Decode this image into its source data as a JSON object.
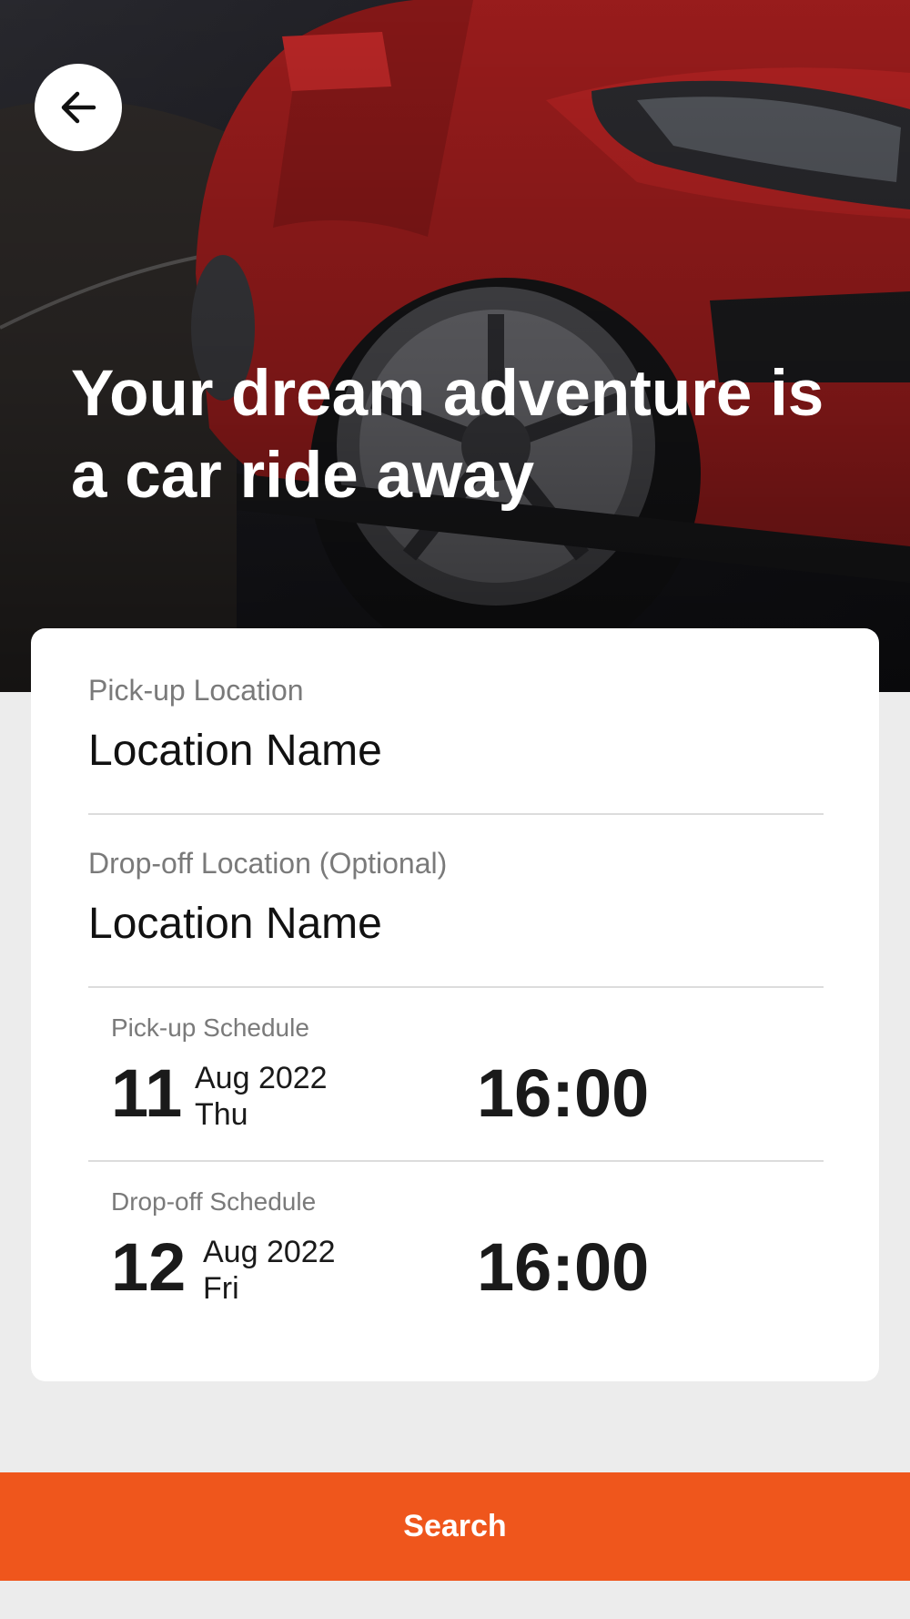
{
  "hero": {
    "headline": "Your dream adventure is a car ride away",
    "back_icon": "arrow-left-icon"
  },
  "form": {
    "pickup_location": {
      "label": "Pick-up Location",
      "value": "Location Name"
    },
    "dropoff_location": {
      "label": "Drop-off Location (Optional)",
      "value": "Location Name"
    },
    "pickup_schedule": {
      "label": "Pick-up Schedule",
      "day": "11",
      "month_year": "Aug 2022",
      "weekday": "Thu",
      "time": "16:00"
    },
    "dropoff_schedule": {
      "label": "Drop-off Schedule",
      "day": "12",
      "month_year": "Aug 2022",
      "weekday": "Fri",
      "time": "16:00"
    }
  },
  "actions": {
    "search_label": "Search"
  },
  "colors": {
    "accent": "#ef561c",
    "card": "#ffffff",
    "background": "#ececec"
  }
}
